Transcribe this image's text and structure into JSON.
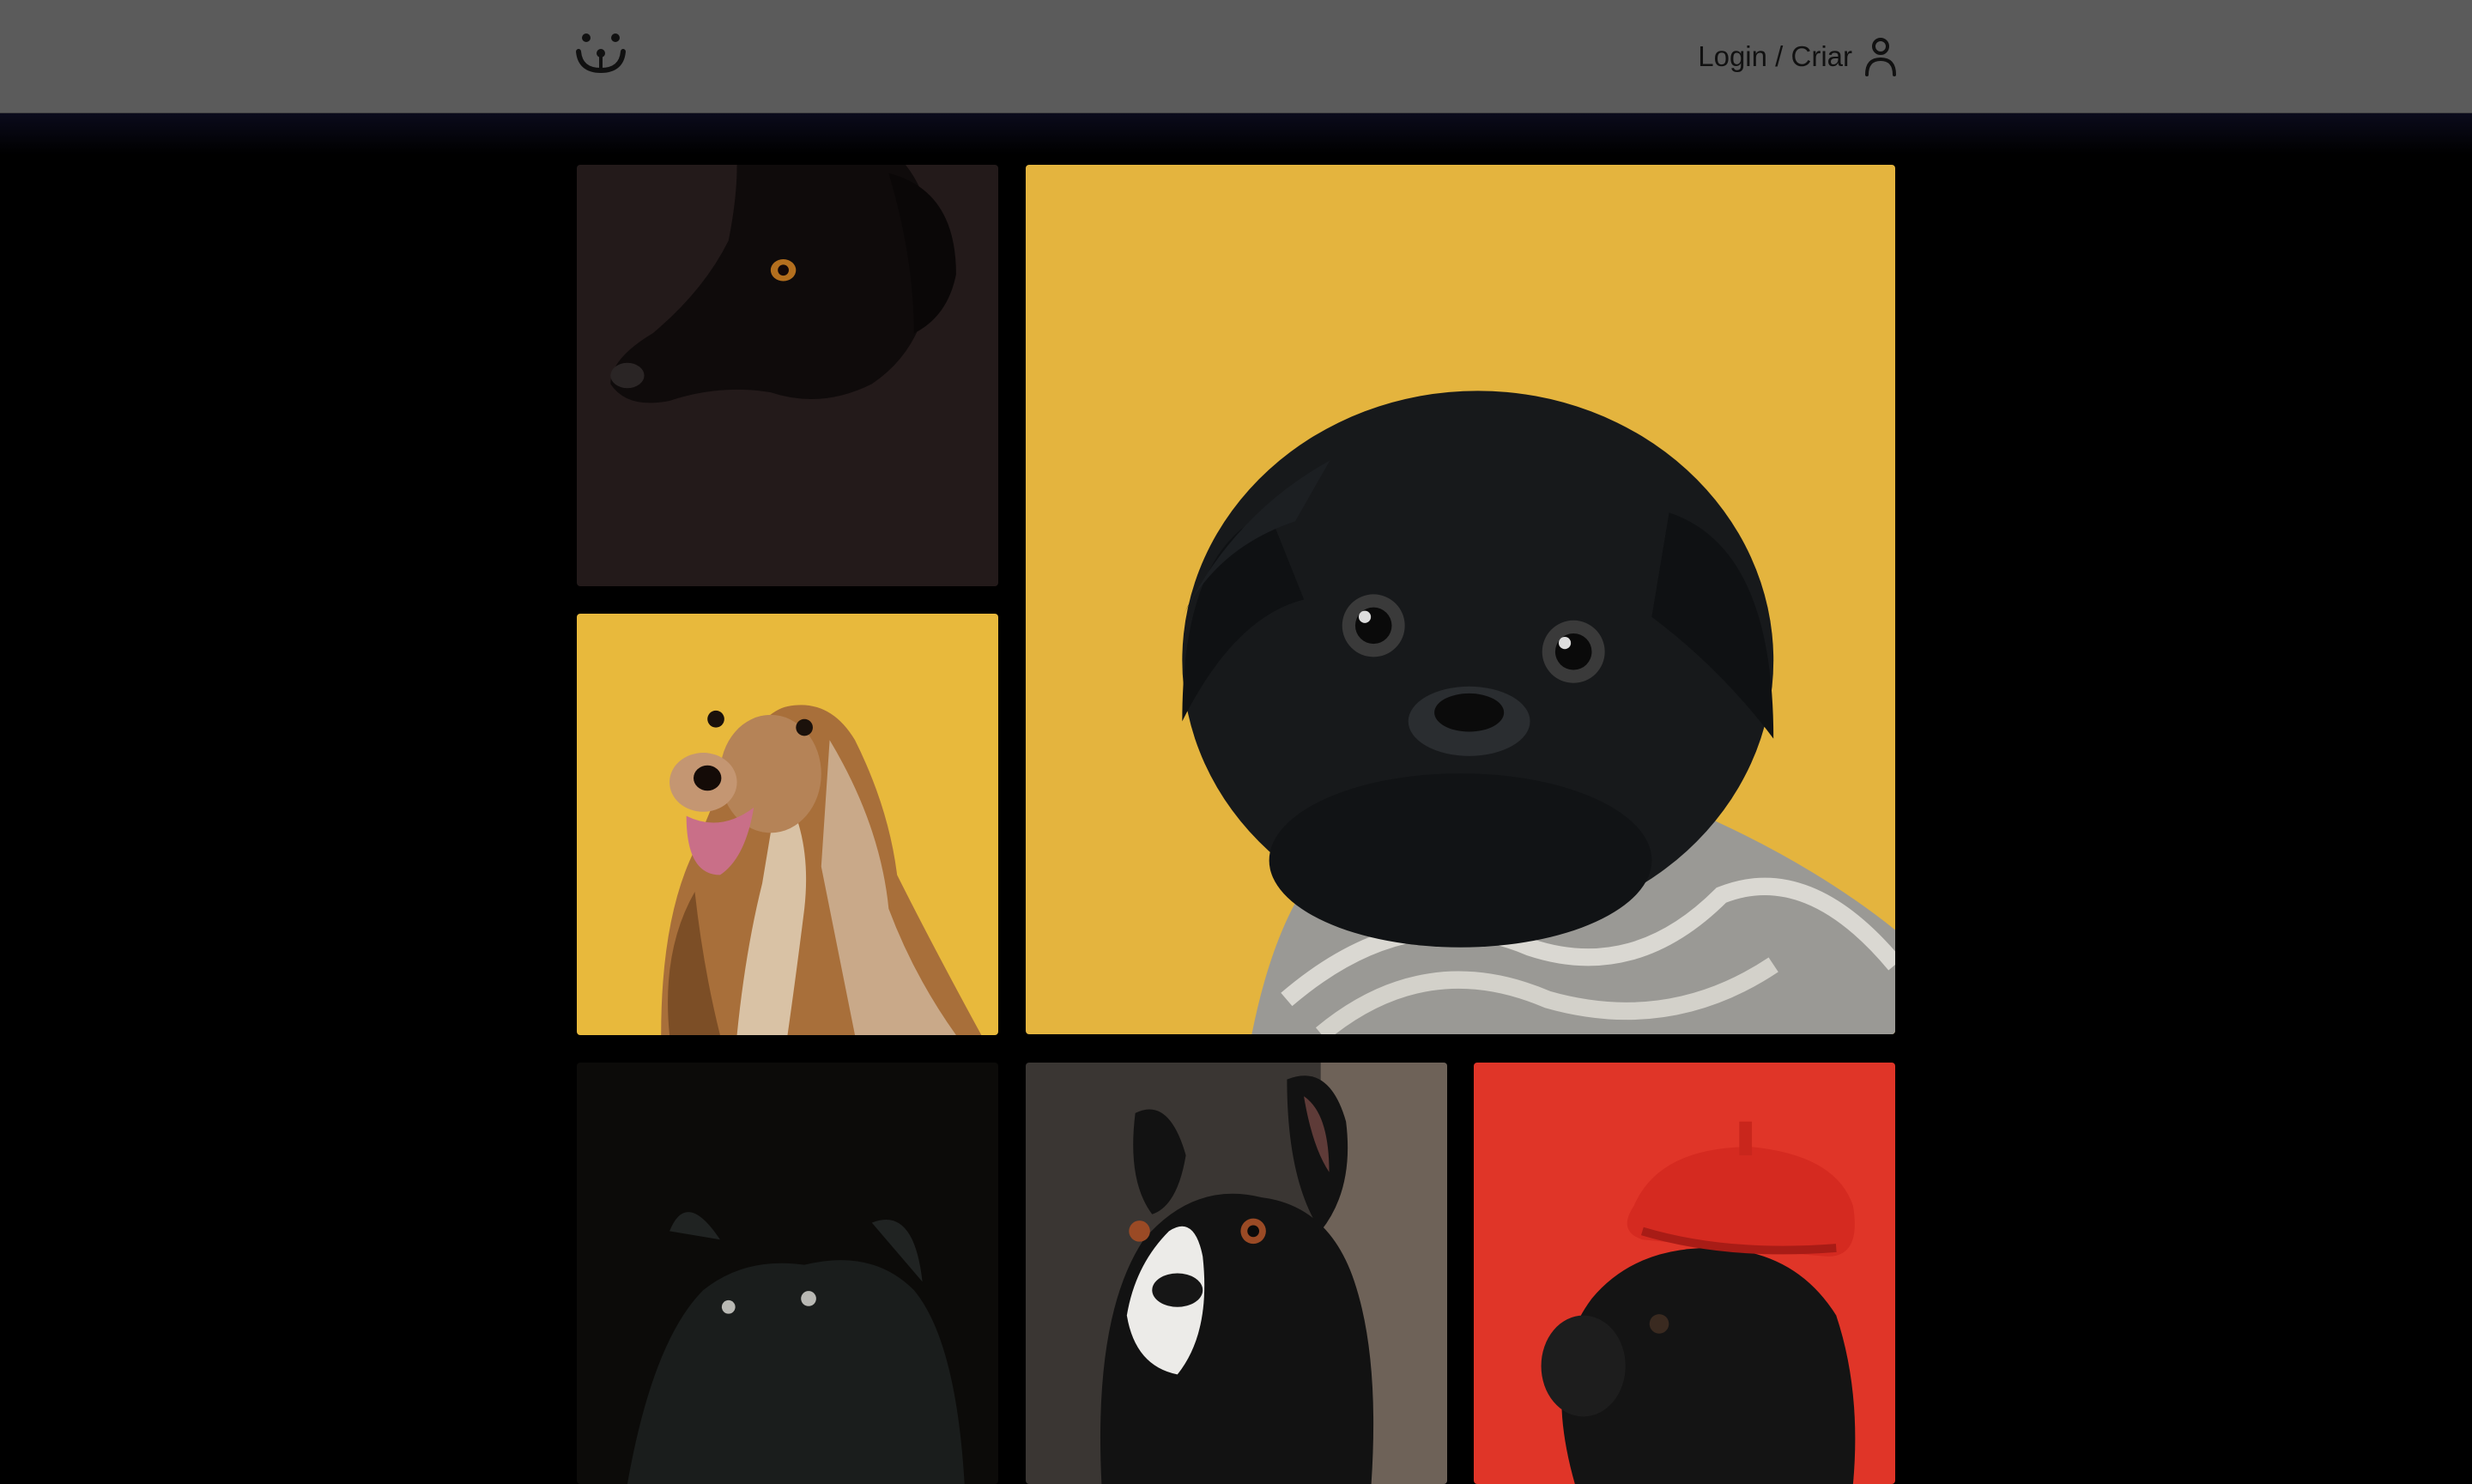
{
  "header": {
    "logo_icon": "dog-face-logo-icon",
    "login_label": "Login / Criar",
    "login_icon": "user-icon",
    "background": "#5b5b5b"
  },
  "gallery": {
    "tiles": [
      {
        "name": "black-dog-profile",
        "background": "#221a1a"
      },
      {
        "name": "black-pug-sweater",
        "background": "#e4b43e"
      },
      {
        "name": "afghan-hound",
        "background": "#e8b93c"
      },
      {
        "name": "black-dog-dark",
        "background": "#0c0b09"
      },
      {
        "name": "boston-terrier",
        "background": "#3a3633"
      },
      {
        "name": "pug-red-beret",
        "background": "#e03528"
      }
    ]
  }
}
